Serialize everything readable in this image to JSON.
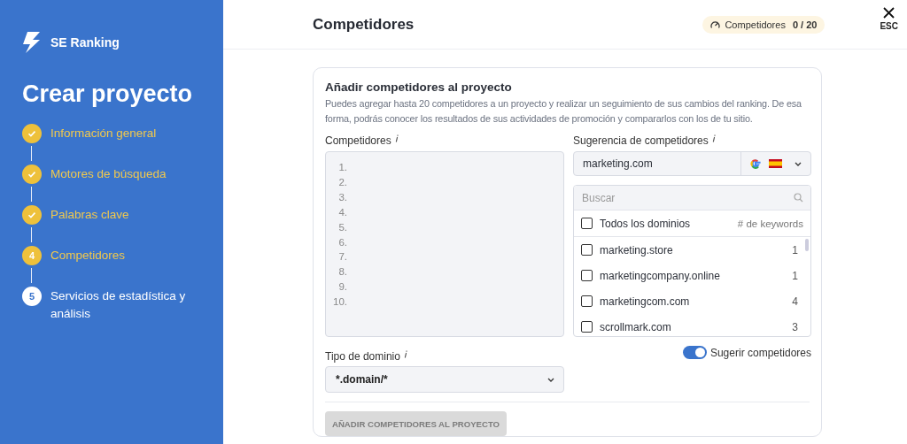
{
  "sidebar": {
    "brand": "SE Ranking",
    "title": "Crear proyecto",
    "steps": [
      {
        "label": "Información general",
        "kind": "done"
      },
      {
        "label": "Motores de búsqueda",
        "kind": "done"
      },
      {
        "label": "Palabras clave",
        "kind": "done"
      },
      {
        "label": "Competidores",
        "marker": "4",
        "kind": "current"
      },
      {
        "label": "Servicios de estadística y análisis",
        "marker": "5",
        "kind": "pending"
      }
    ]
  },
  "header": {
    "title": "Competidores",
    "badge_label": "Competidores",
    "badge_count": "0 / 20",
    "close_label": "ESC"
  },
  "card": {
    "title": "Añadir competidores al proyecto",
    "description": "Puedes agregar hasta 20 competidores a un proyecto y realizar un seguimiento de sus cambios del ranking. De esa forma, podrás conocer los resultados de sus actividades de promoción y compararlos con los de tu sitio.",
    "competitors_label": "Competidores",
    "competitor_lines": [
      "1.",
      "2.",
      "3.",
      "4.",
      "5.",
      "6.",
      "7.",
      "8.",
      "9.",
      "10."
    ],
    "domain_type_label": "Tipo de dominio",
    "domain_type_value": "*.domain/*",
    "submit": {
      "label": "AÑADIR COMPETIDORES AL PROYECTO",
      "disabled": true
    },
    "suggestion": {
      "label": "Sugerencia de competidores",
      "domain_value": "marketing.com",
      "search_placeholder": "Buscar",
      "all_row": {
        "label": "Todos los dominios",
        "checked": false,
        "column_label": "# de keywords"
      },
      "rows": [
        {
          "domain": "marketing.store",
          "keywords": "1",
          "checked": false
        },
        {
          "domain": "marketingcompany.online",
          "keywords": "1",
          "checked": false
        },
        {
          "domain": "marketingcom.com",
          "keywords": "4",
          "checked": false
        },
        {
          "domain": "scrollmark.com",
          "keywords": "3",
          "checked": false
        }
      ],
      "toggle": {
        "label": "Sugerir competidores",
        "on": true
      }
    }
  }
}
